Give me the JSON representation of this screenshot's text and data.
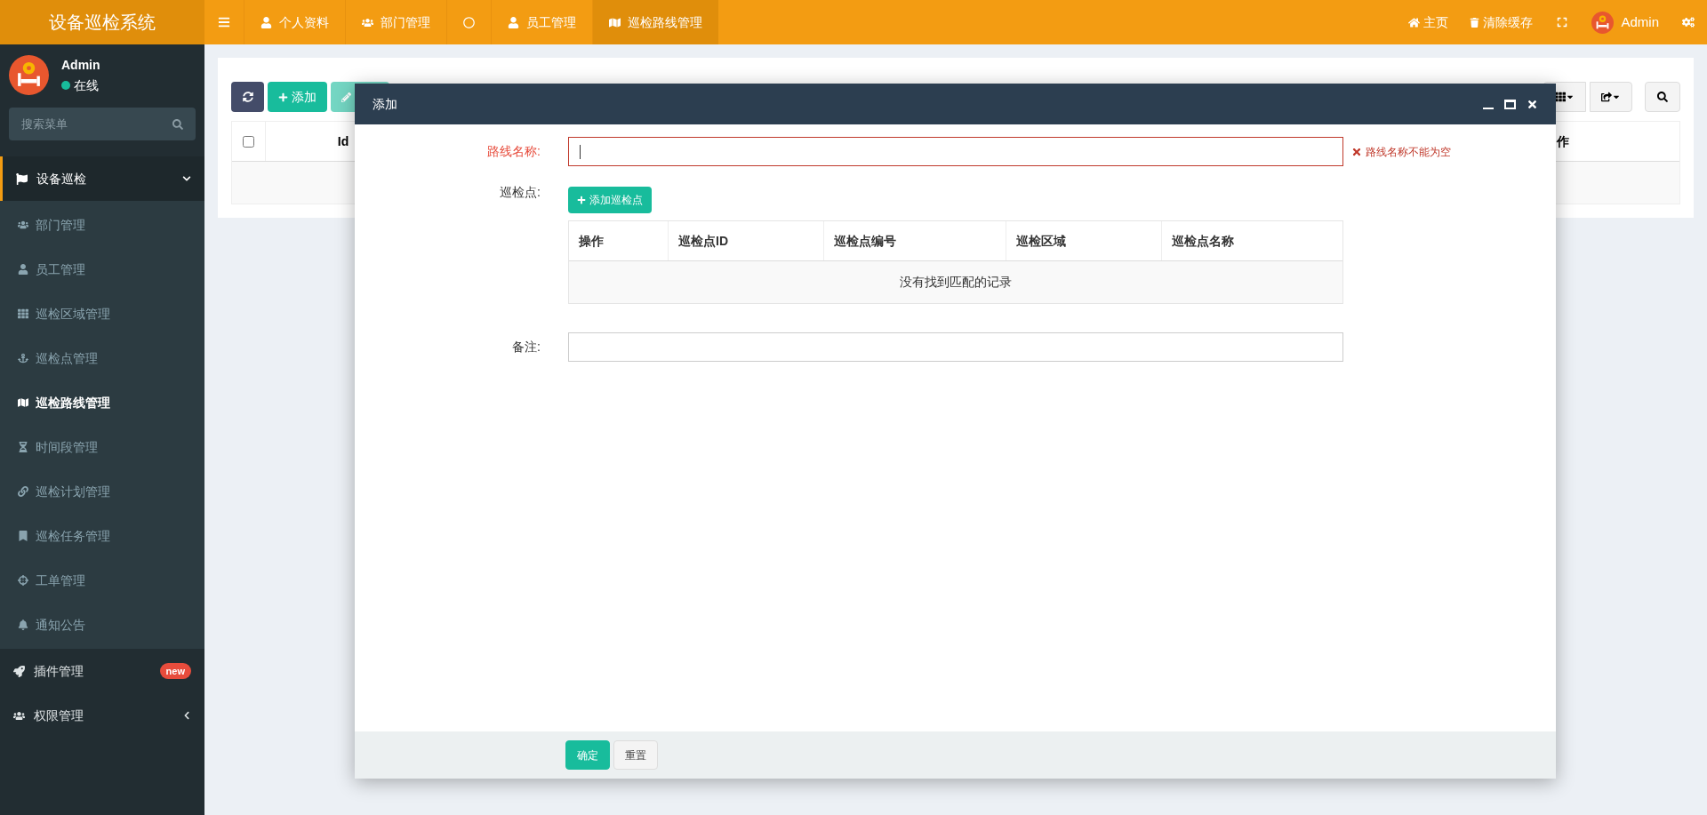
{
  "app_title": "设备巡检系统",
  "top_tabs": [
    {
      "label": "个人资料",
      "selected": false
    },
    {
      "label": "部门管理",
      "selected": false
    },
    {
      "selected": false
    },
    {
      "label": "员工管理",
      "selected": false
    },
    {
      "label": "巡检路线管理",
      "selected": true
    }
  ],
  "header_links": [
    "主页",
    "清除缓存"
  ],
  "header_user": "Admin",
  "sidebar": {
    "user": {
      "name": "Admin",
      "status": "在线"
    },
    "search": {
      "placeholder": "搜索菜单"
    },
    "menu": [
      {
        "label": "设备巡检",
        "expanded": true,
        "children": [
          {
            "label": "部门管理",
            "selected": false
          },
          {
            "label": "员工管理",
            "selected": false
          },
          {
            "label": "巡检区域管理",
            "selected": false
          },
          {
            "label": "巡检点管理",
            "selected": false
          },
          {
            "label": "巡检路线管理",
            "selected": true
          },
          {
            "label": "时间段管理",
            "selected": false
          },
          {
            "label": "巡检计划管理",
            "selected": false
          },
          {
            "label": "巡检任务管理",
            "selected": false
          },
          {
            "label": "工单管理",
            "selected": false
          },
          {
            "label": "通知公告",
            "selected": false
          }
        ]
      },
      {
        "label": "插件管理",
        "expanded": false,
        "badge": "new"
      },
      {
        "label": "权限管理",
        "expanded": false
      }
    ]
  },
  "background_page": {
    "add_button": "添加",
    "select_all_checked": false,
    "table_columns": [
      "Id",
      "作"
    ]
  },
  "modal": {
    "title": "添加",
    "route_name": {
      "label": "路线名称:",
      "invalid": true,
      "error": "路线名称不能为空"
    },
    "points": {
      "label": "巡检点:",
      "add_button": "添加巡检点",
      "columns": [
        "操作",
        "巡检点ID",
        "巡检点编号",
        "巡检区域",
        "巡检点名称"
      ],
      "empty": "没有找到匹配的记录"
    },
    "remark": {
      "label": "备注:"
    },
    "buttons": [
      {
        "label": "确定",
        "kind": "primary"
      },
      {
        "label": "重置",
        "kind": "default"
      }
    ]
  }
}
